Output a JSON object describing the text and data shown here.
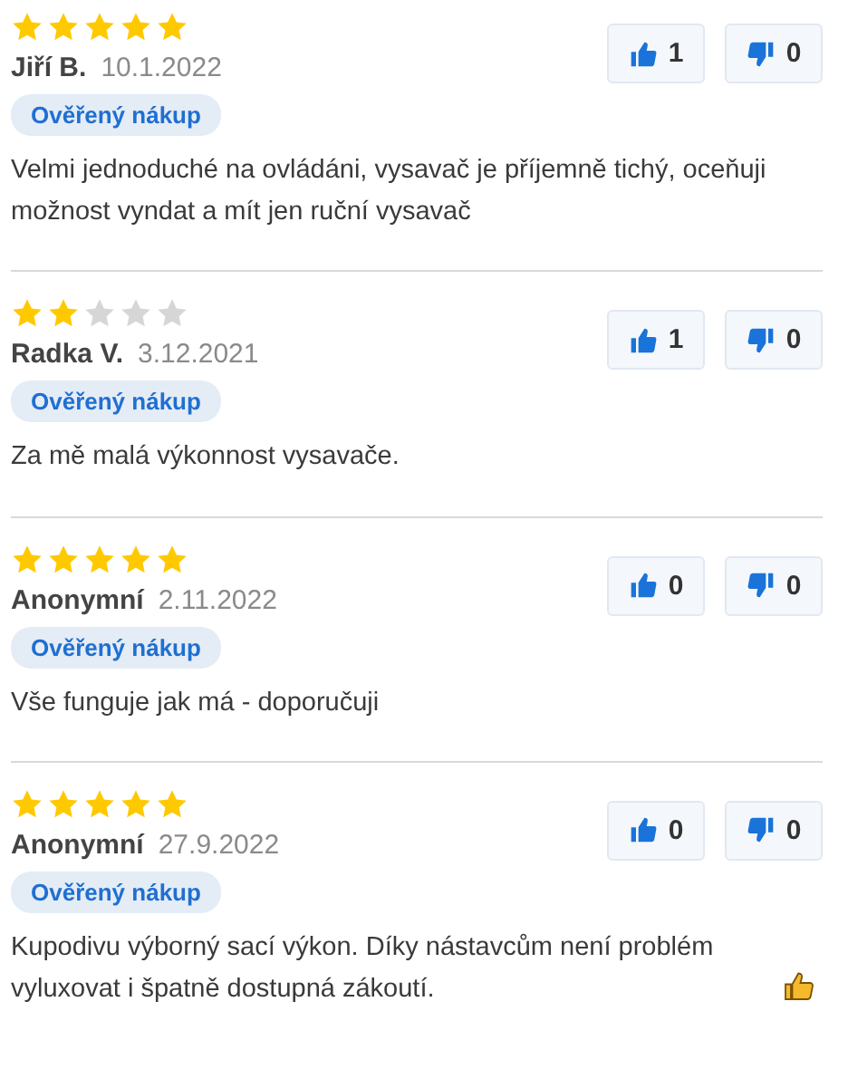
{
  "reviews": [
    {
      "stars": 5,
      "author": "Jiří B.",
      "date": "10.1.2022",
      "badge": "Ověřený nákup",
      "text": "Velmi jednoduché na ovládáni, vysavač je příjemně tichý, oceňuji možnost vyndat a mít jen ruční vysavač",
      "likes": "1",
      "dislikes": "0",
      "emoji": false
    },
    {
      "stars": 2,
      "author": "Radka V.",
      "date": "3.12.2021",
      "badge": "Ověřený nákup",
      "text": "Za mě malá výkonnost vysavače.",
      "likes": "1",
      "dislikes": "0",
      "emoji": false
    },
    {
      "stars": 5,
      "author": "Anonymní",
      "date": "2.11.2022",
      "badge": "Ověřený nákup",
      "text": "Vše funguje jak má - doporučuji",
      "likes": "0",
      "dislikes": "0",
      "emoji": false
    },
    {
      "stars": 5,
      "author": "Anonymní",
      "date": "27.9.2022",
      "badge": "Ověřený nákup",
      "text": "Kupodivu výborný sací výkon. Díky nástavcům není problém vyluxovat i špatně dostupná zákoutí.",
      "likes": "0",
      "dislikes": "0",
      "emoji": true
    }
  ]
}
